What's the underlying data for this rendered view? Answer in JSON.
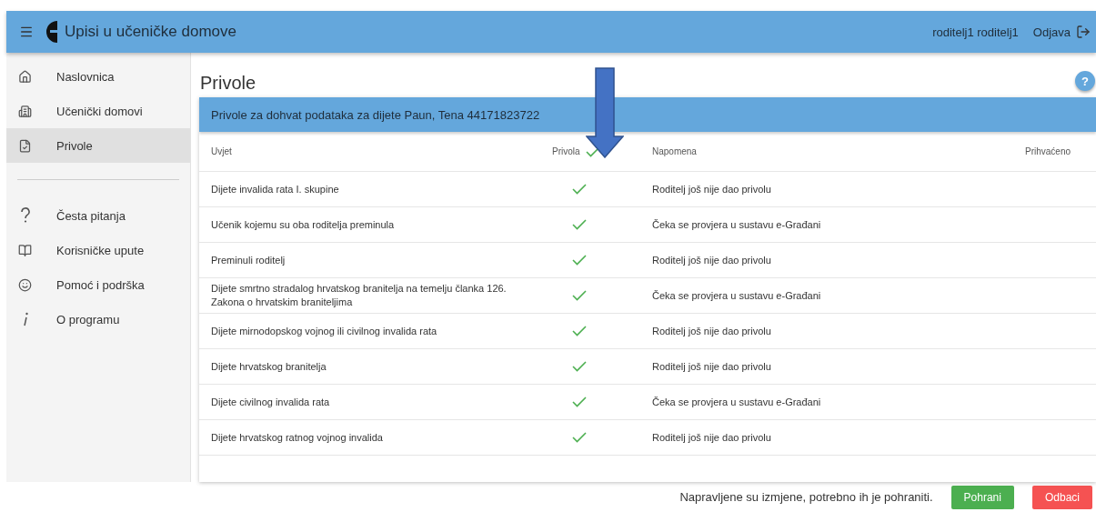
{
  "header": {
    "title": "Upisi u učeničke domove",
    "user": "roditelj1 roditelj1",
    "logout": "Odjava"
  },
  "sidebar": {
    "items": [
      {
        "label": "Naslovnica",
        "selected": false
      },
      {
        "label": "Učenički domovi",
        "selected": false
      },
      {
        "label": "Privole",
        "selected": true
      }
    ],
    "secondary_items": [
      {
        "label": "Česta pitanja"
      },
      {
        "label": "Korisničke upute"
      },
      {
        "label": "Pomoć i podrška"
      },
      {
        "label": "O programu"
      }
    ]
  },
  "page": {
    "title": "Privole",
    "help": "?"
  },
  "card": {
    "title": "Privole za dohvat podataka za dijete Paun, Tena 44171823722"
  },
  "table": {
    "columns": [
      "Uvjet",
      "Privola",
      "Napomena",
      "Prihvaćeno"
    ],
    "all_checked": true,
    "rows": [
      {
        "condition": "Dijete invalida rata I. skupine",
        "checked": true,
        "note": "Roditelj još nije dao privolu"
      },
      {
        "condition": "Učenik kojemu su oba roditelja preminula",
        "checked": true,
        "note": "Čeka se provjera u sustavu e-Građani"
      },
      {
        "condition": "Preminuli roditelj",
        "checked": true,
        "note": "Roditelj još nije dao privolu"
      },
      {
        "condition": "Dijete smrtno stradalog hrvatskog branitelja na temelju članka 126. Zakona o hrvatskim braniteljima",
        "checked": true,
        "note": "Čeka se provjera u sustavu e-Građani"
      },
      {
        "condition": "Dijete mirnodopskog vojnog ili civilnog invalida rata",
        "checked": true,
        "note": "Roditelj još nije dao privolu"
      },
      {
        "condition": "Dijete hrvatskog branitelja",
        "checked": true,
        "note": "Roditelj još nije dao privolu"
      },
      {
        "condition": "Dijete civilnog invalida rata",
        "checked": true,
        "note": "Čeka se provjera u sustavu e-Građani"
      },
      {
        "condition": "Dijete hrvatskog ratnog vojnog invalida",
        "checked": true,
        "note": "Roditelj još nije dao privolu"
      }
    ]
  },
  "save_bar": {
    "message": "Napravljene su izmjene, potrebno ih je pohraniti.",
    "buttons": [
      {
        "label": "Pohrani",
        "kind": "save"
      },
      {
        "label": "Odbaci",
        "kind": "discard"
      }
    ]
  }
}
